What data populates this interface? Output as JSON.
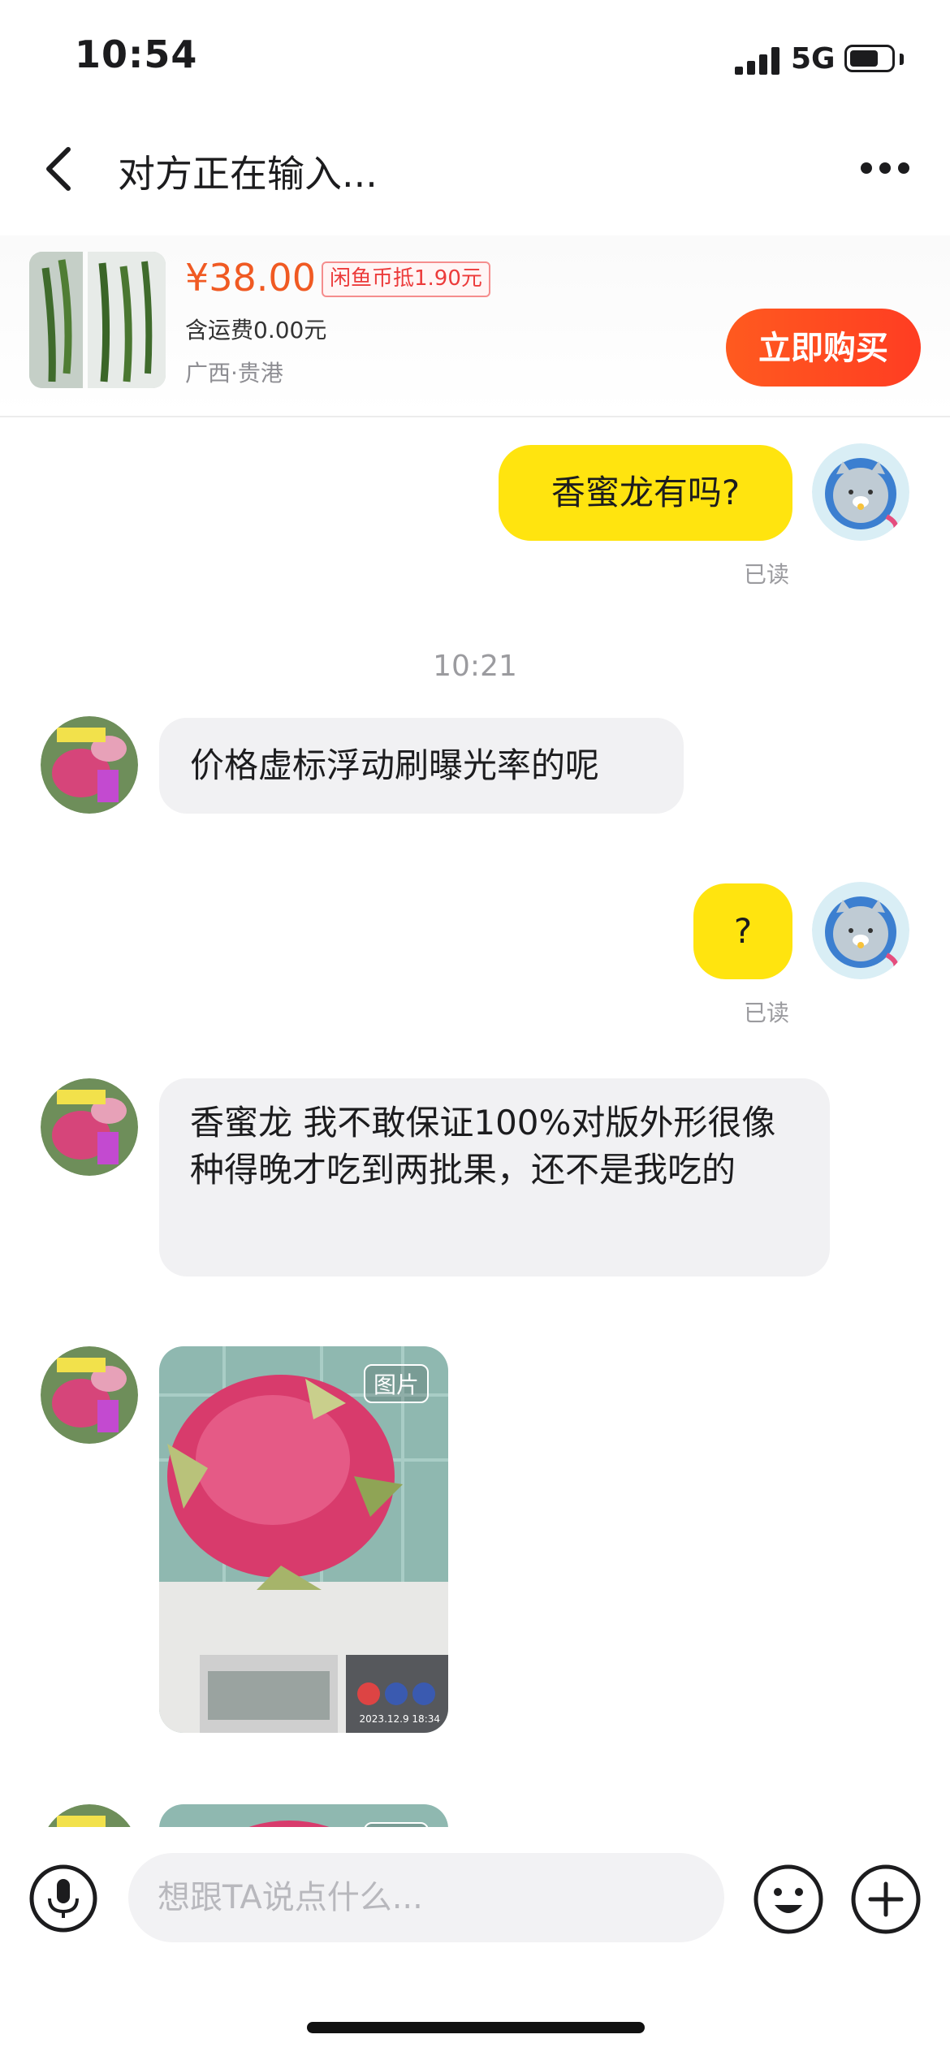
{
  "status_bar": {
    "time": "10:54",
    "network": "5G",
    "battery_level": 0.7
  },
  "header": {
    "title": "对方正在输入...",
    "back_icon": "chevron-left-icon",
    "more_icon": "more-dots-icon"
  },
  "product": {
    "price": "¥38.00",
    "coin_tag": "闲鱼币抵1.90元",
    "shipping": "含运费0.00元",
    "location": "广西·贵港",
    "buy_label": "立即购买"
  },
  "messages": [
    {
      "side": "right",
      "text": "香蜜龙有吗?",
      "status": "已读"
    },
    {
      "timestamp": "10:21"
    },
    {
      "side": "left",
      "text": "价格虚标浮动刷曝光率的呢"
    },
    {
      "side": "right",
      "text": "?",
      "status": "已读"
    },
    {
      "side": "left",
      "text": "香蜜龙 我不敢保证100%对版外形很像种得晚才吃到两批果，还不是我吃的"
    },
    {
      "side": "left",
      "type": "image",
      "tag": "图片",
      "stamp": "2023.12.9 18:34"
    },
    {
      "side": "left",
      "type": "image",
      "tag": "图片"
    }
  ],
  "composer": {
    "placeholder": "想跟TA说点什么...",
    "value": "",
    "icons": [
      "microphone-icon",
      "emoji-icon",
      "plus-icon"
    ]
  },
  "colors": {
    "accent": "#ff4a1f",
    "price": "#f05a23",
    "bubble_self": "#ffe40f",
    "bubble_other": "#f1f1f3"
  }
}
